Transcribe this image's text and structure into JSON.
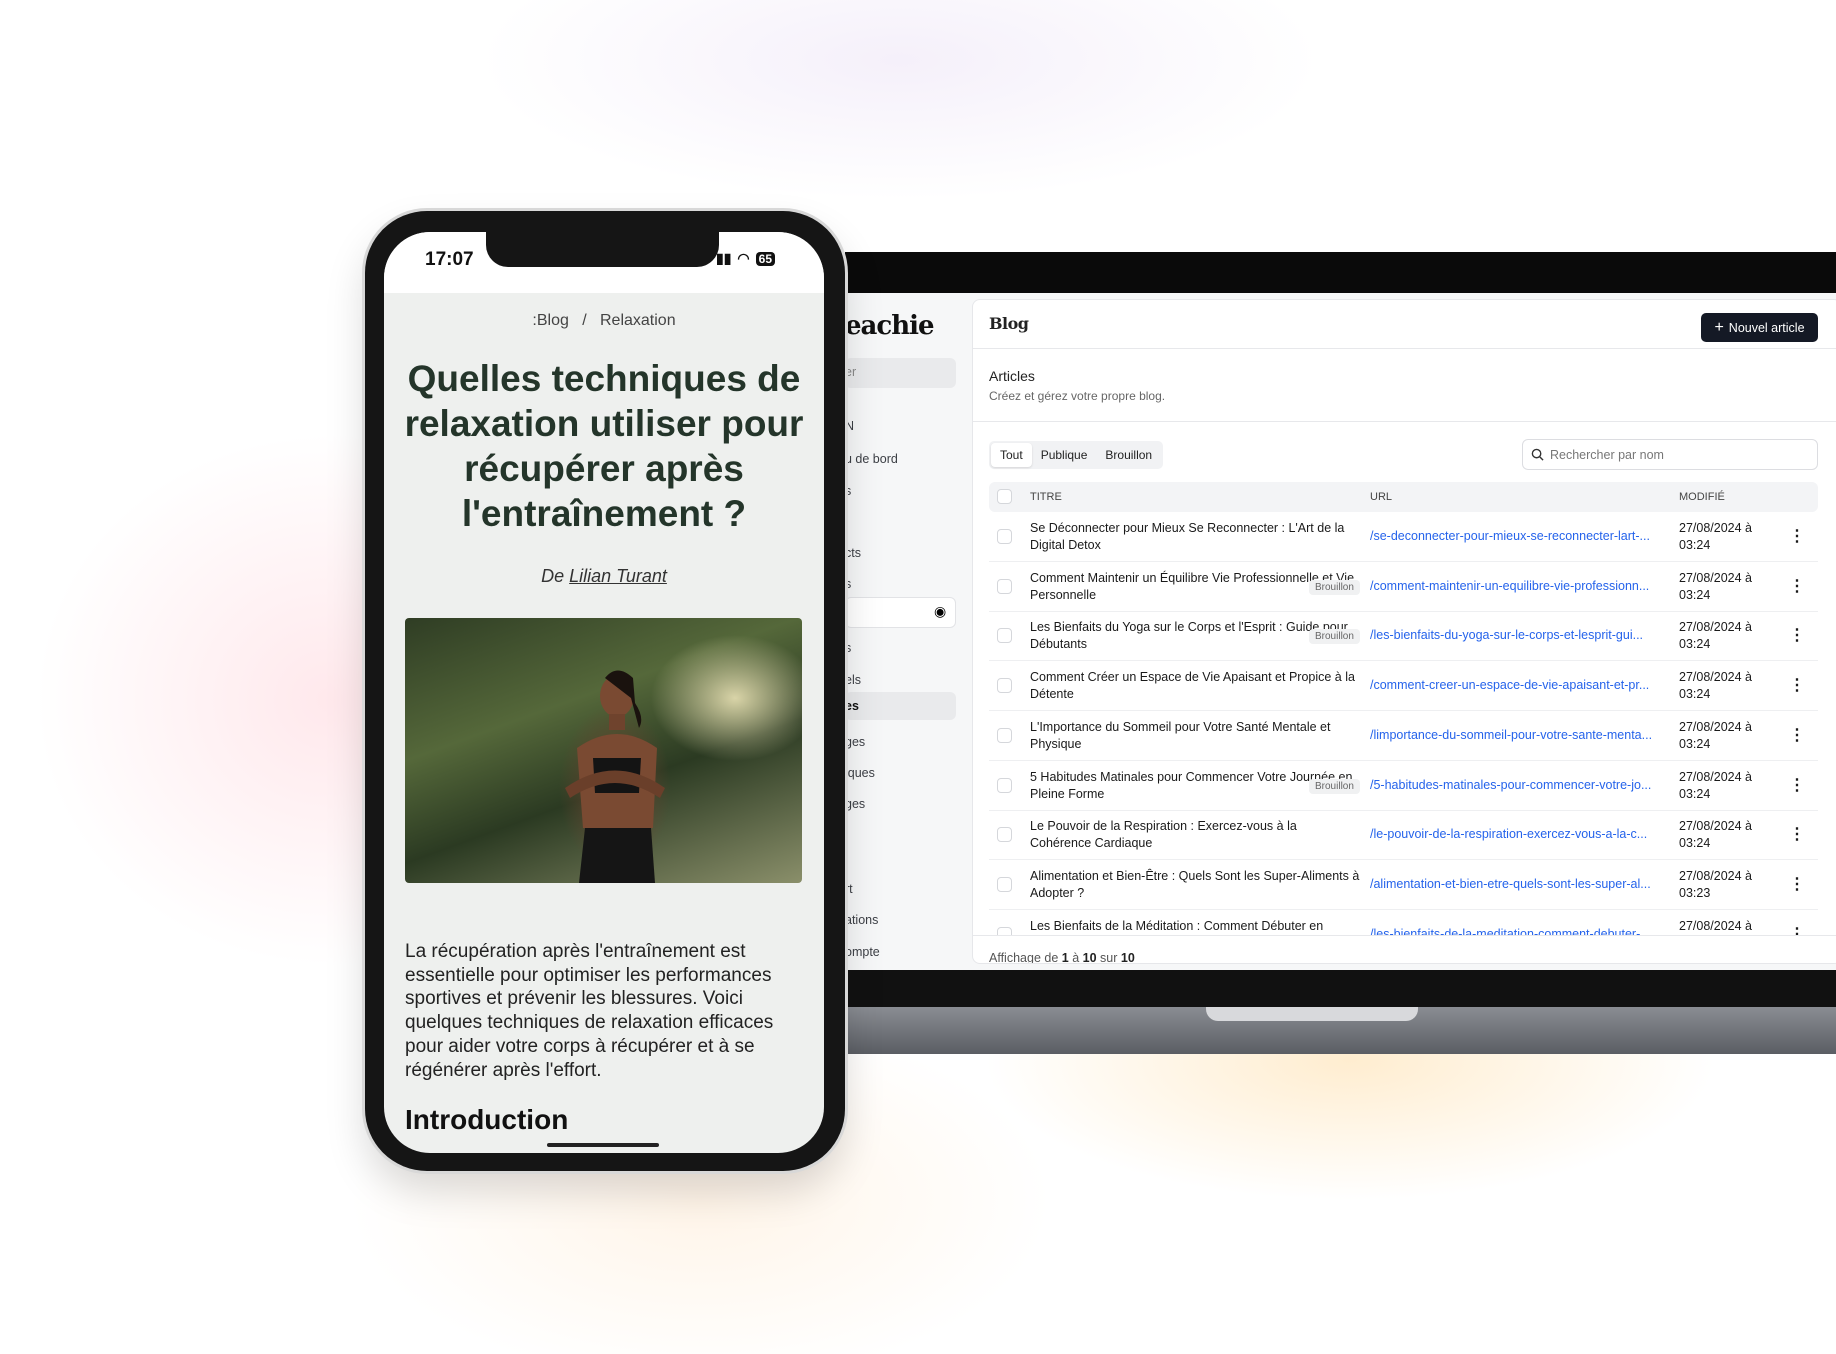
{
  "laptop": {
    "sidebar": {
      "logo": "eachie",
      "search_fragment": "er",
      "fragments": [
        "N",
        "u de bord",
        "s",
        "cts",
        "s",
        "s",
        "els",
        "es",
        "ges",
        "iques",
        "ges",
        "rt",
        "ations",
        "ompte"
      ],
      "active_fragment_index": 7
    },
    "header": {
      "title": "Blog",
      "new_button": "Nouvel article"
    },
    "section": {
      "title": "Articles",
      "subtitle": "Créez et gérez votre propre blog."
    },
    "tabs": [
      {
        "label": "Tout",
        "active": true
      },
      {
        "label": "Publique",
        "active": false
      },
      {
        "label": "Brouillon",
        "active": false
      }
    ],
    "search": {
      "placeholder": "Rechercher par nom"
    },
    "columns": {
      "title": "TITRE",
      "url": "URL",
      "modified": "MODIFIÉ"
    },
    "rows": [
      {
        "title": "Se Déconnecter pour Mieux Se Reconnecter : L'Art de la Digital Detox",
        "badge": "",
        "url": "/se-deconnecter-pour-mieux-se-reconnecter-lart-...",
        "date": "27/08/2024 à",
        "time": "03:24"
      },
      {
        "title": "Comment Maintenir un Équilibre Vie Professionnelle et Vie Personnelle",
        "badge": "Brouillon",
        "url": "/comment-maintenir-un-equilibre-vie-professionn...",
        "date": "27/08/2024 à",
        "time": "03:24"
      },
      {
        "title": "Les Bienfaits du Yoga sur le Corps et l'Esprit : Guide pour Débutants",
        "badge": "Brouillon",
        "url": "/les-bienfaits-du-yoga-sur-le-corps-et-lesprit-gui...",
        "date": "27/08/2024 à",
        "time": "03:24"
      },
      {
        "title": "Comment Créer un Espace de Vie Apaisant et Propice à la Détente",
        "badge": "",
        "url": "/comment-creer-un-espace-de-vie-apaisant-et-pr...",
        "date": "27/08/2024 à",
        "time": "03:24"
      },
      {
        "title": "L'Importance du Sommeil pour Votre Santé Mentale et Physique",
        "badge": "",
        "url": "/limportance-du-sommeil-pour-votre-sante-menta...",
        "date": "27/08/2024 à",
        "time": "03:24"
      },
      {
        "title": "5 Habitudes Matinales pour Commencer Votre Journée en Pleine Forme",
        "badge": "Brouillon",
        "url": "/5-habitudes-matinales-pour-commencer-votre-jo...",
        "date": "27/08/2024 à",
        "time": "03:24"
      },
      {
        "title": "Le Pouvoir de la Respiration : Exercez-vous à la Cohérence Cardiaque",
        "badge": "",
        "url": "/le-pouvoir-de-la-respiration-exercez-vous-a-la-c...",
        "date": "27/08/2024 à",
        "time": "03:24"
      },
      {
        "title": "Alimentation et Bien-Être : Quels Sont les Super-Aliments à Adopter ?",
        "badge": "",
        "url": "/alimentation-et-bien-etre-quels-sont-les-super-al...",
        "date": "27/08/2024 à",
        "time": "03:23"
      },
      {
        "title": "Les Bienfaits de la Méditation : Comment Débuter en",
        "badge": "",
        "url": "/les-bienfaits-de-la-meditation-comment-debuter-",
        "date": "27/08/2024 à",
        "time": ""
      }
    ],
    "footer": {
      "prefix": "Affichage de",
      "from": "1",
      "mid1": "à",
      "to": "10",
      "mid2": "sur",
      "total": "10"
    },
    "colors": {
      "link": "#2563eb",
      "button": "#141925"
    }
  },
  "phone": {
    "time": "17:07",
    "battery": "65",
    "breadcrumb": ":Blog   /   Relaxation",
    "title": "Quelles techniques de relaxation utiliser pour récupérer après l'entraînement ?",
    "author_prefix": "De",
    "author": "Lilian Turant",
    "paragraph": "La récupération après l'entraînement est essentielle pour optimiser les performances sportives et prévenir les blessures. Voici quelques techniques de relaxation efficaces pour aider votre corps à récupérer et à se régénérer après l'effort.",
    "heading": "Introduction",
    "colors": {
      "title": "#24352a",
      "background": "#eef0ee"
    }
  }
}
